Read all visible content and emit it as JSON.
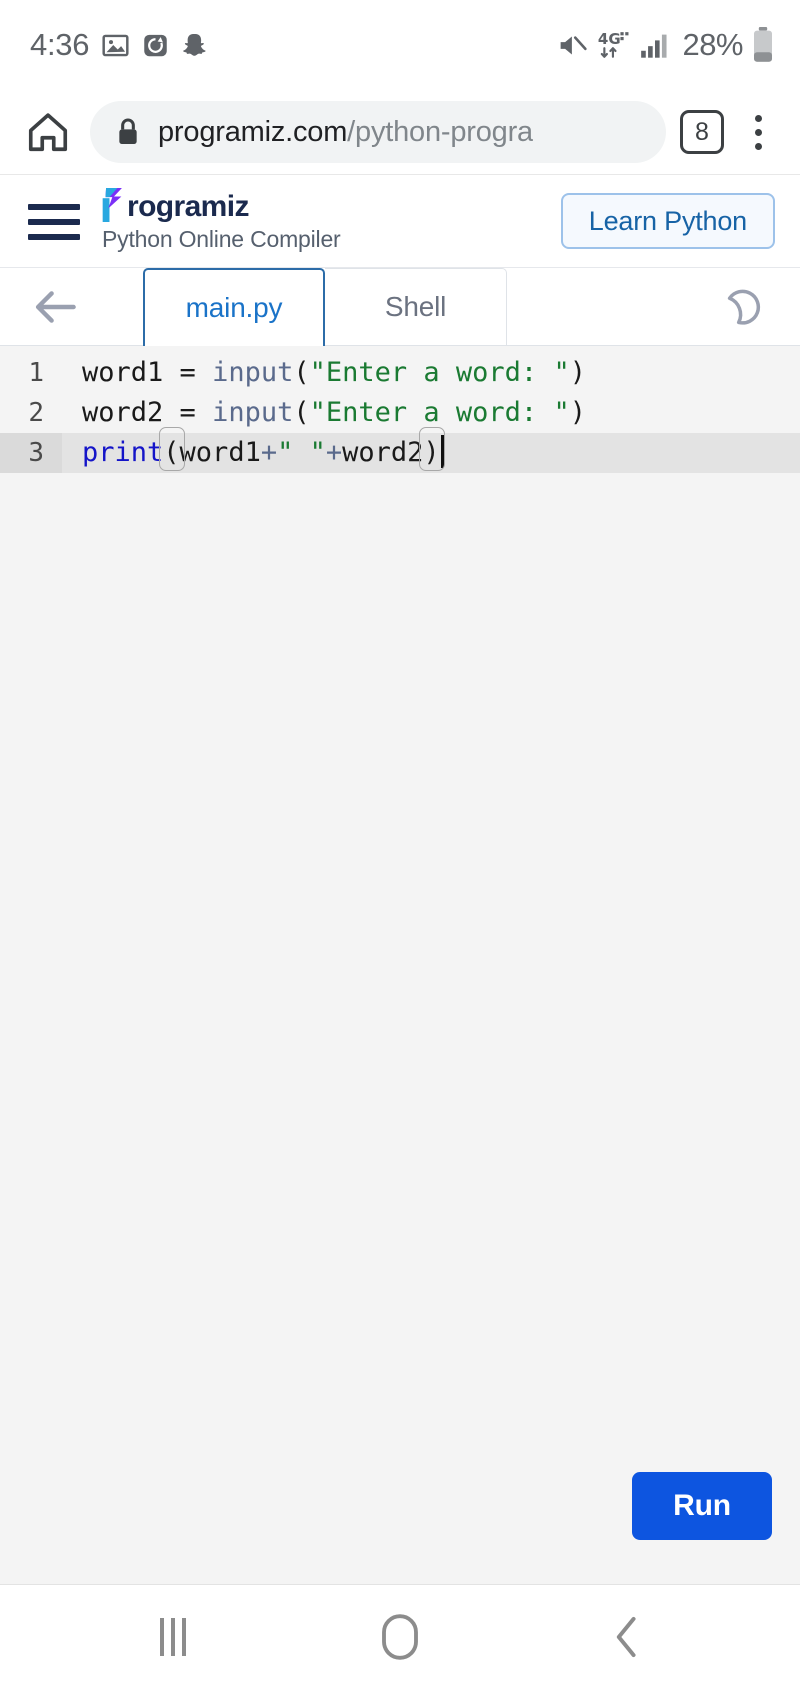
{
  "status_bar": {
    "time": "4:36",
    "left_icons": [
      "photos-icon",
      "alarm-icon",
      "snapchat-icon"
    ],
    "right_icons": [
      "mute-icon",
      "network-4g-plus-icon",
      "signal-bars-icon"
    ],
    "network_label": "4G",
    "battery_percent": "28%",
    "battery_icon": "battery-icon"
  },
  "browser": {
    "home_icon": "home-icon",
    "lock_icon": "lock-icon",
    "url_domain": "programiz.com",
    "url_path": "/python-progra",
    "url_full": "programiz.com/python-progra",
    "tab_count": "8",
    "menu_icon": "overflow-menu-icon"
  },
  "site_header": {
    "menu_icon": "hamburger-menu-icon",
    "brand_mark": "programiz-p-mark-icon",
    "brand_name": "rogramiz",
    "brand_full": "Programiz",
    "subtitle": "Python Online Compiler",
    "learn_button": "Learn Python"
  },
  "editor_toolbar": {
    "back_icon": "back-arrow-icon",
    "theme_icon": "moon-icon",
    "tabs": [
      {
        "label": "main.py",
        "active": true
      },
      {
        "label": "Shell",
        "active": false
      }
    ]
  },
  "editor": {
    "lines": [
      {
        "number": "1",
        "text": "word1 = input(\"Enter a word: \")",
        "active": false
      },
      {
        "number": "2",
        "text": "word2 = input(\"Enter a word: \")",
        "active": false
      },
      {
        "number": "3",
        "text": "print(word1+\" \"+word2)",
        "active": true
      }
    ],
    "line1": {
      "var": "word1 ",
      "assign": "= ",
      "fn": "input",
      "open": "(",
      "str": "\"Enter a word: \"",
      "close": ")"
    },
    "line2": {
      "var": "word2 ",
      "assign": "= ",
      "fn": "input",
      "open": "(",
      "str": "\"Enter a word: \"",
      "close": ")"
    },
    "line3": {
      "kw": "print",
      "open": "(",
      "arg1": "word1",
      "plus1": "+",
      "str": "\" \"",
      "plus2": "+",
      "arg2": "word2",
      "close": ")"
    }
  },
  "actions": {
    "run_button": "Run"
  },
  "nav_bar": {
    "recents": "recents-icon",
    "home": "home-nav-icon",
    "back": "back-nav-icon"
  },
  "colors": {
    "accent_blue": "#0d55e0",
    "tab_active_blue": "#1a73c8",
    "brand_navy": "#1b2a4e",
    "string_green": "#1a7a32",
    "keyword_blue": "#1414c8",
    "editor_bg": "#f4f4f4",
    "active_line": "#e3e3e3"
  }
}
